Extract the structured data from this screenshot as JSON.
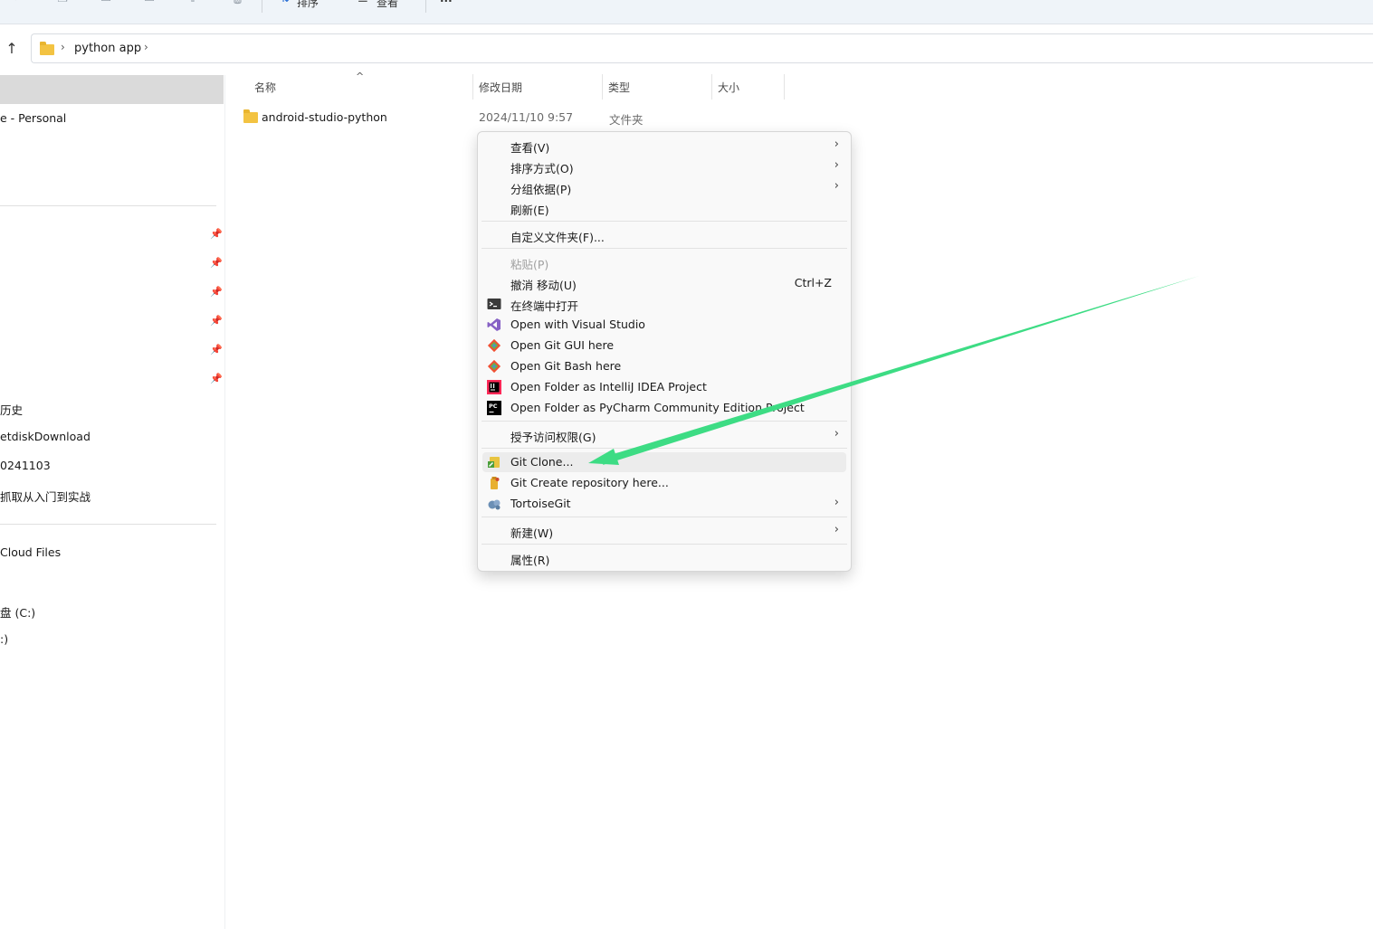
{
  "toolbar": {
    "sort_label": "排序",
    "view_label": "查看",
    "more_label": "···"
  },
  "address": {
    "crumb": "python app",
    "chevron": "›"
  },
  "sidebar": {
    "partial_item": "e - Personal",
    "history_item": "历史",
    "netdisk_item": "etdiskDownload",
    "date_item": "0241103",
    "course_item": "抓取从入门到实战",
    "cloud_item": " Cloud Files",
    "drive_c": "盘 (C:)",
    "drive_other": ":)"
  },
  "columns": {
    "name": "名称",
    "modified": "修改日期",
    "type": "类型",
    "size": "大小"
  },
  "files": [
    {
      "name": "android-studio-python",
      "modified": "2024/11/10 9:57",
      "type": "文件夹"
    }
  ],
  "context_menu": {
    "view": "查看(V)",
    "sort": "排序方式(O)",
    "group": "分组依据(P)",
    "refresh": "刷新(E)",
    "customize": "自定义文件夹(F)...",
    "paste": "粘贴(P)",
    "undo": "撤消 移动(U)",
    "undo_shortcut": "Ctrl+Z",
    "terminal": "在终端中打开",
    "visual_studio": "Open with Visual Studio",
    "git_gui": "Open Git GUI here",
    "git_bash": "Open Git Bash here",
    "intellij": "Open Folder as IntelliJ IDEA Project",
    "pycharm": "Open Folder as PyCharm Community Edition Project",
    "access": "授予访问权限(G)",
    "git_clone": "Git Clone...",
    "git_create": "Git Create repository here...",
    "tortoise": "TortoiseGit",
    "new": "新建(W)",
    "properties": "属性(R)",
    "submenu_arrow": "›"
  },
  "colors": {
    "annotation_arrow": "#3ddc84",
    "folder": "#f3c342",
    "selection": "#dadada"
  }
}
